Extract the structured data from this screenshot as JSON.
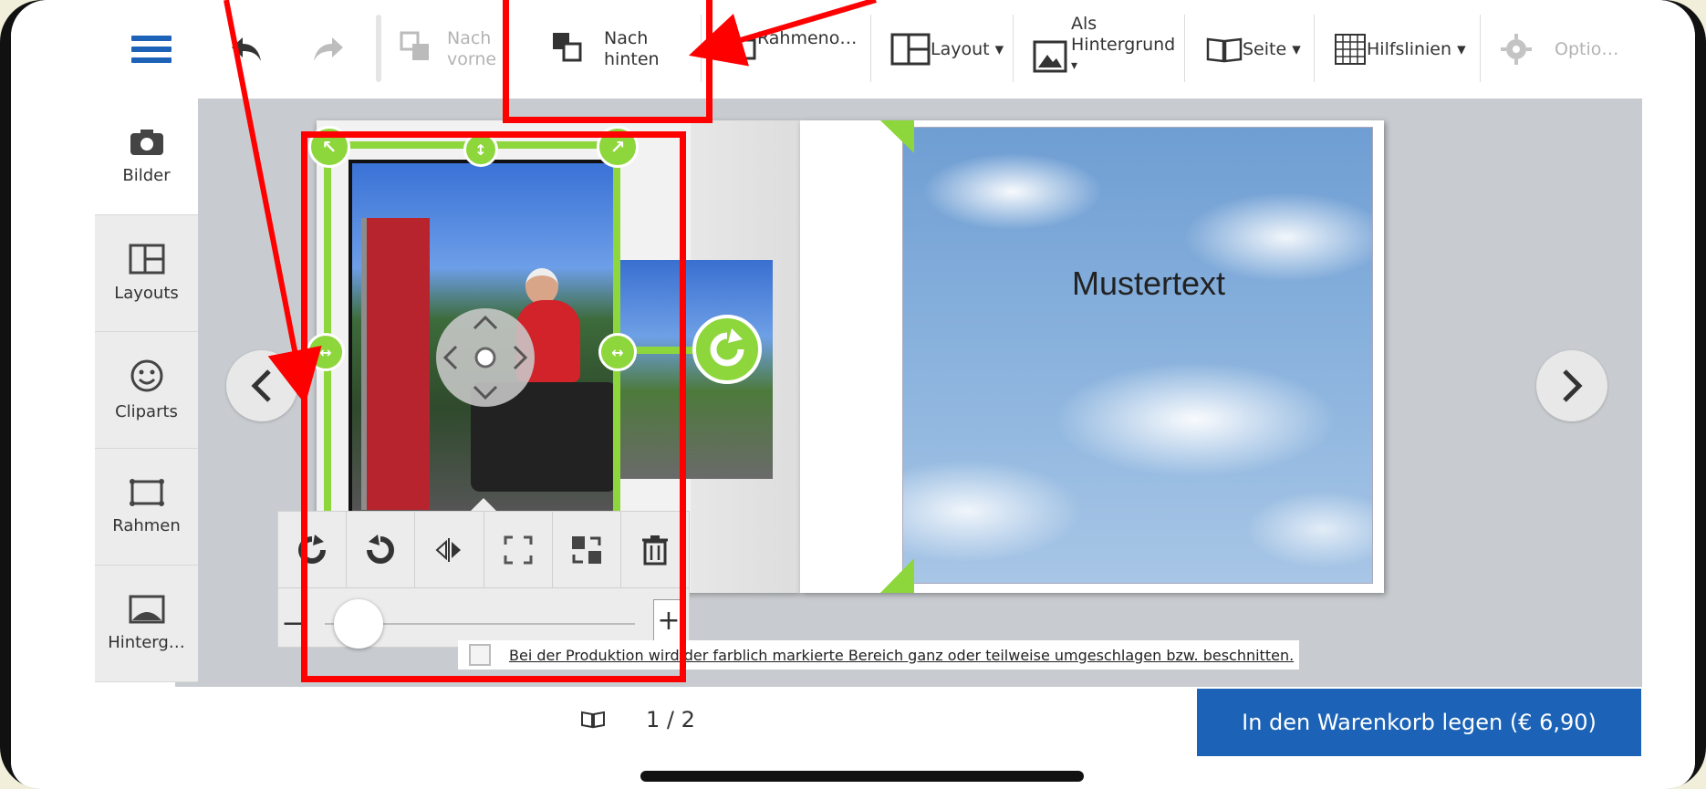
{
  "toolbar": {
    "nach_vorne": [
      "Nach",
      "vorne"
    ],
    "nach_hinten": [
      "Nach",
      "hinten"
    ],
    "rahmen": "Rahmeno…",
    "layout": "Layout ▾",
    "als_hintergrund": [
      "Als",
      "Hintergrund",
      "▾"
    ],
    "seite": "Seite ▾",
    "hilfslinien": "Hilfslinien ▾",
    "optionen": "Optio…"
  },
  "sidebar": {
    "items": [
      {
        "label": "Bilder",
        "icon": "camera-icon"
      },
      {
        "label": "Layouts",
        "icon": "layout-icon"
      },
      {
        "label": "Cliparts",
        "icon": "smiley-icon"
      },
      {
        "label": "Rahmen",
        "icon": "frame-icon"
      },
      {
        "label": "Hinterg…",
        "icon": "background-icon"
      }
    ]
  },
  "canvas": {
    "mustertext": "Mustertext",
    "notice": "Bei der Produktion wird der farblich markierte Bereich ganz oder teilweise umgeschlagen bzw. beschnitten."
  },
  "edit_panel": {
    "zoom_minus": "−",
    "zoom_plus": "+"
  },
  "footer": {
    "page_indicator": "1 / 2",
    "cart_button": "In den Warenkorb legen (€ 6,90)"
  },
  "colors": {
    "accent_blue": "#1c63b7",
    "handle_green": "#8dd63c",
    "annotation_red": "#ff0000"
  }
}
